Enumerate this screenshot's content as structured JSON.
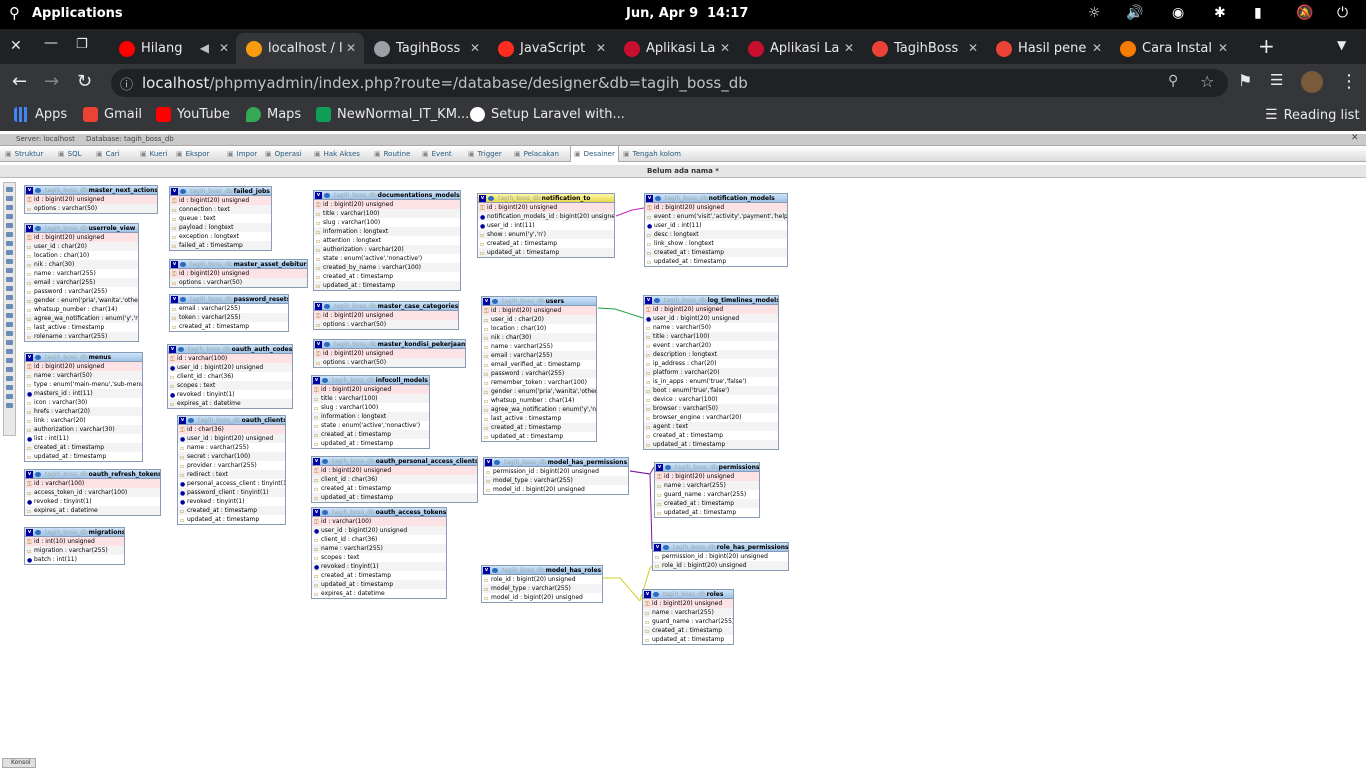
{
  "os": {
    "apps_label": "Applications",
    "clock": "Jun, Apr 9",
    "time": "14:17"
  },
  "tabs": [
    {
      "title": "Hilang",
      "icon": "youtube-icon",
      "color": "#ff0000"
    },
    {
      "title": "localhost / l",
      "icon": "phpmyadmin-icon",
      "color": "#f89c0e",
      "active": true
    },
    {
      "title": "TagihBoss",
      "icon": "globe-icon",
      "color": "#9aa0a6"
    },
    {
      "title": "JavaScript",
      "icon": "laravel-icon",
      "color": "#ff2d20"
    },
    {
      "title": "Aplikasi La",
      "icon": "dw-icon",
      "color": "#c8102e"
    },
    {
      "title": "Aplikasi La",
      "icon": "dw-icon",
      "color": "#c8102e"
    },
    {
      "title": "TagihBoss",
      "icon": "dot-icon",
      "color": "#ea4335"
    },
    {
      "title": "Hasil pene",
      "icon": "gmail-icon",
      "color": "#ea4335"
    },
    {
      "title": "Cara Instal",
      "icon": "firebase-icon",
      "color": "#f57c00"
    }
  ],
  "address": {
    "host": "localhost",
    "path": "/phpmyadmin/index.php?route=/database/designer&db=tagih_boss_db"
  },
  "bookmarks": [
    {
      "label": "Apps",
      "color": "#4285f4"
    },
    {
      "label": "Gmail",
      "color": "#ea4335"
    },
    {
      "label": "YouTube",
      "color": "#ff0000"
    },
    {
      "label": "Maps",
      "color": "#34a853"
    },
    {
      "label": "NewNormal_IT_KM...",
      "color": "#0f9d58"
    },
    {
      "label": "Setup Laravel with...",
      "color": "#ffffff"
    }
  ],
  "reading_list": "Reading list",
  "pma": {
    "breadcrumb_server": "Server: localhost",
    "breadcrumb_db": "Database: tagih_boss_db",
    "menu": [
      "Struktur",
      "SQL",
      "Cari",
      "Kueri",
      "Ekspor",
      "Impor",
      "Operasi",
      "Hak Akses",
      "Routine",
      "Event",
      "Trigger",
      "Pelacakan",
      "Desainer",
      "Tengah kolom"
    ],
    "active_menu": "Desainer",
    "page_name": "Belum ada nama *",
    "console": "Konsol",
    "db": "tagih_boss_db"
  },
  "tables": [
    {
      "id": "master_next_actions",
      "rows": [
        [
          "id : bigint(20) unsigned",
          "pk"
        ],
        [
          "options : varchar(50)",
          ""
        ]
      ]
    },
    {
      "id": "userrole_view",
      "rows": [
        [
          "id : bigint(20) unsigned",
          "pk"
        ],
        [
          "user_id : char(20)",
          ""
        ],
        [
          "location : char(10)",
          ""
        ],
        [
          "nik : char(30)",
          ""
        ],
        [
          "name : varchar(255)",
          ""
        ],
        [
          "email : varchar(255)",
          ""
        ],
        [
          "password : varchar(255)",
          ""
        ],
        [
          "gender : enum('pria','wanita','other')",
          ""
        ],
        [
          "whatsup_number : char(14)",
          ""
        ],
        [
          "agree_wa_notification : enum('y','n')",
          ""
        ],
        [
          "last_active : timestamp",
          ""
        ],
        [
          "rolename : varchar(255)",
          ""
        ]
      ]
    },
    {
      "id": "menus",
      "rows": [
        [
          "id : bigint(20) unsigned",
          "pk"
        ],
        [
          "name : varchar(50)",
          ""
        ],
        [
          "type : enum('main-menu','sub-menu')",
          ""
        ],
        [
          "masters_id : int(11)",
          "fk"
        ],
        [
          "icon : varchar(30)",
          ""
        ],
        [
          "hrefs : varchar(20)",
          ""
        ],
        [
          "link : varchar(20)",
          ""
        ],
        [
          "authorization : varchar(30)",
          ""
        ],
        [
          "list : int(11)",
          "fk"
        ],
        [
          "created_at : timestamp",
          ""
        ],
        [
          "updated_at : timestamp",
          ""
        ]
      ]
    },
    {
      "id": "oauth_refresh_tokens",
      "rows": [
        [
          "id : varchar(100)",
          "pk"
        ],
        [
          "access_token_id : varchar(100)",
          ""
        ],
        [
          "revoked : tinyint(1)",
          "fk"
        ],
        [
          "expires_at : datetime",
          ""
        ]
      ]
    },
    {
      "id": "migrations",
      "rows": [
        [
          "id : int(10) unsigned",
          "pk"
        ],
        [
          "migration : varchar(255)",
          ""
        ],
        [
          "batch : int(11)",
          "fk"
        ]
      ]
    },
    {
      "id": "failed_jobs",
      "rows": [
        [
          "id : bigint(20) unsigned",
          "pk"
        ],
        [
          "connection : text",
          ""
        ],
        [
          "queue : text",
          ""
        ],
        [
          "payload : longtext",
          ""
        ],
        [
          "exception : longtext",
          ""
        ],
        [
          "failed_at : timestamp",
          ""
        ]
      ]
    },
    {
      "id": "master_asset_debiturs",
      "rows": [
        [
          "id : bigint(20) unsigned",
          "pk"
        ],
        [
          "options : varchar(50)",
          ""
        ]
      ]
    },
    {
      "id": "password_resets",
      "rows": [
        [
          "email : varchar(255)",
          ""
        ],
        [
          "token : varchar(255)",
          ""
        ],
        [
          "created_at : timestamp",
          ""
        ]
      ]
    },
    {
      "id": "oauth_auth_codes",
      "rows": [
        [
          "id : varchar(100)",
          "pk"
        ],
        [
          "user_id : bigint(20) unsigned",
          "fk"
        ],
        [
          "client_id : char(36)",
          ""
        ],
        [
          "scopes : text",
          ""
        ],
        [
          "revoked : tinyint(1)",
          "fk"
        ],
        [
          "expires_at : datetime",
          ""
        ]
      ]
    },
    {
      "id": "oauth_clients",
      "rows": [
        [
          "id : char(36)",
          "pk"
        ],
        [
          "user_id : bigint(20) unsigned",
          "fk"
        ],
        [
          "name : varchar(255)",
          ""
        ],
        [
          "secret : varchar(100)",
          ""
        ],
        [
          "provider : varchar(255)",
          ""
        ],
        [
          "redirect : text",
          ""
        ],
        [
          "personal_access_client : tinyint(1)",
          "fk"
        ],
        [
          "password_client : tinyint(1)",
          "fk"
        ],
        [
          "revoked : tinyint(1)",
          "fk"
        ],
        [
          "created_at : timestamp",
          ""
        ],
        [
          "updated_at : timestamp",
          ""
        ]
      ]
    },
    {
      "id": "documentations_models",
      "rows": [
        [
          "id : bigint(20) unsigned",
          "pk"
        ],
        [
          "title : varchar(100)",
          ""
        ],
        [
          "slug : varchar(100)",
          ""
        ],
        [
          "information : longtext",
          ""
        ],
        [
          "attention : longtext",
          ""
        ],
        [
          "authorization : varchar(20)",
          ""
        ],
        [
          "state : enum('active','nonactive')",
          ""
        ],
        [
          "created_by_name : varchar(100)",
          ""
        ],
        [
          "created_at : timestamp",
          ""
        ],
        [
          "updated_at : timestamp",
          ""
        ]
      ]
    },
    {
      "id": "master_case_categories",
      "rows": [
        [
          "id : bigint(20) unsigned",
          "pk"
        ],
        [
          "options : varchar(50)",
          ""
        ]
      ]
    },
    {
      "id": "master_kondisi_pekerjaans",
      "rows": [
        [
          "id : bigint(20) unsigned",
          "pk"
        ],
        [
          "options : varchar(50)",
          ""
        ]
      ]
    },
    {
      "id": "infocoll_models",
      "rows": [
        [
          "id : bigint(20) unsigned",
          "pk"
        ],
        [
          "title : varchar(100)",
          ""
        ],
        [
          "slug : varchar(100)",
          ""
        ],
        [
          "information : longtext",
          ""
        ],
        [
          "state : enum('active','nonactive')",
          ""
        ],
        [
          "created_at : timestamp",
          ""
        ],
        [
          "updated_at : timestamp",
          ""
        ]
      ]
    },
    {
      "id": "oauth_personal_access_clients",
      "rows": [
        [
          "id : bigint(20) unsigned",
          "pk"
        ],
        [
          "client_id : char(36)",
          ""
        ],
        [
          "created_at : timestamp",
          ""
        ],
        [
          "updated_at : timestamp",
          ""
        ]
      ]
    },
    {
      "id": "oauth_access_tokens",
      "rows": [
        [
          "id : varchar(100)",
          "pk"
        ],
        [
          "user_id : bigint(20) unsigned",
          "fk"
        ],
        [
          "client_id : char(36)",
          ""
        ],
        [
          "name : varchar(255)",
          ""
        ],
        [
          "scopes : text",
          ""
        ],
        [
          "revoked : tinyint(1)",
          "fk"
        ],
        [
          "created_at : timestamp",
          ""
        ],
        [
          "updated_at : timestamp",
          ""
        ],
        [
          "expires_at : datetime",
          ""
        ]
      ]
    },
    {
      "id": "notification_to",
      "yellow": true,
      "rows": [
        [
          "id : bigint(20) unsigned",
          "pk"
        ],
        [
          "notification_models_id : bigint(20) unsigned",
          "fk"
        ],
        [
          "user_id : int(11)",
          "fk"
        ],
        [
          "show : enum('y','n')",
          ""
        ],
        [
          "created_at : timestamp",
          ""
        ],
        [
          "updated_at : timestamp",
          ""
        ]
      ]
    },
    {
      "id": "users",
      "rows": [
        [
          "id : bigint(20) unsigned",
          "pk"
        ],
        [
          "user_id : char(20)",
          ""
        ],
        [
          "location : char(10)",
          ""
        ],
        [
          "nik : char(30)",
          ""
        ],
        [
          "name : varchar(255)",
          ""
        ],
        [
          "email : varchar(255)",
          ""
        ],
        [
          "email_verified_at : timestamp",
          ""
        ],
        [
          "password : varchar(255)",
          ""
        ],
        [
          "remember_token : varchar(100)",
          ""
        ],
        [
          "gender : enum('pria','wanita','other')",
          ""
        ],
        [
          "whatsup_number : char(14)",
          ""
        ],
        [
          "agree_wa_notification : enum('y','n')",
          ""
        ],
        [
          "last_active : timestamp",
          ""
        ],
        [
          "created_at : timestamp",
          ""
        ],
        [
          "updated_at : timestamp",
          ""
        ]
      ]
    },
    {
      "id": "model_has_permissions",
      "rows": [
        [
          "permission_id : bigint(20) unsigned",
          ""
        ],
        [
          "model_type : varchar(255)",
          ""
        ],
        [
          "model_id : bigint(20) unsigned",
          ""
        ]
      ]
    },
    {
      "id": "model_has_roles",
      "rows": [
        [
          "role_id : bigint(20) unsigned",
          ""
        ],
        [
          "model_type : varchar(255)",
          ""
        ],
        [
          "model_id : bigint(20) unsigned",
          ""
        ]
      ]
    },
    {
      "id": "notification_models",
      "rows": [
        [
          "id : bigint(20) unsigned",
          "pk"
        ],
        [
          "event : enum('visit','activity','payment','helper')",
          ""
        ],
        [
          "user_id : int(11)",
          "fk"
        ],
        [
          "desc : longtext",
          ""
        ],
        [
          "link_show : longtext",
          ""
        ],
        [
          "created_at : timestamp",
          ""
        ],
        [
          "updated_at : timestamp",
          ""
        ]
      ]
    },
    {
      "id": "log_timelines_models",
      "rows": [
        [
          "id : bigint(20) unsigned",
          "pk"
        ],
        [
          "user_id : bigint(20) unsigned",
          "fk"
        ],
        [
          "name : varchar(50)",
          ""
        ],
        [
          "title : varchar(100)",
          ""
        ],
        [
          "event : varchar(20)",
          ""
        ],
        [
          "description : longtext",
          ""
        ],
        [
          "ip_address : char(20)",
          ""
        ],
        [
          "platform : varchar(20)",
          ""
        ],
        [
          "is_in_apps : enum('true','false')",
          ""
        ],
        [
          "boot : enum('true','false')",
          ""
        ],
        [
          "device : varchar(100)",
          ""
        ],
        [
          "browser : varchar(50)",
          ""
        ],
        [
          "browser_engine : varchar(20)",
          ""
        ],
        [
          "agent : text",
          ""
        ],
        [
          "created_at : timestamp",
          ""
        ],
        [
          "updated_at : timestamp",
          ""
        ]
      ]
    },
    {
      "id": "permissions",
      "rows": [
        [
          "id : bigint(20) unsigned",
          "pk"
        ],
        [
          "name : varchar(255)",
          ""
        ],
        [
          "guard_name : varchar(255)",
          ""
        ],
        [
          "created_at : timestamp",
          ""
        ],
        [
          "updated_at : timestamp",
          ""
        ]
      ]
    },
    {
      "id": "role_has_permissions",
      "rows": [
        [
          "permission_id : bigint(20) unsigned",
          ""
        ],
        [
          "role_id : bigint(20) unsigned",
          ""
        ]
      ]
    },
    {
      "id": "roles",
      "rows": [
        [
          "id : bigint(20) unsigned",
          "pk"
        ],
        [
          "name : varchar(255)",
          ""
        ],
        [
          "guard_name : varchar(255)",
          ""
        ],
        [
          "created_at : timestamp",
          ""
        ],
        [
          "updated_at : timestamp",
          ""
        ]
      ]
    }
  ]
}
